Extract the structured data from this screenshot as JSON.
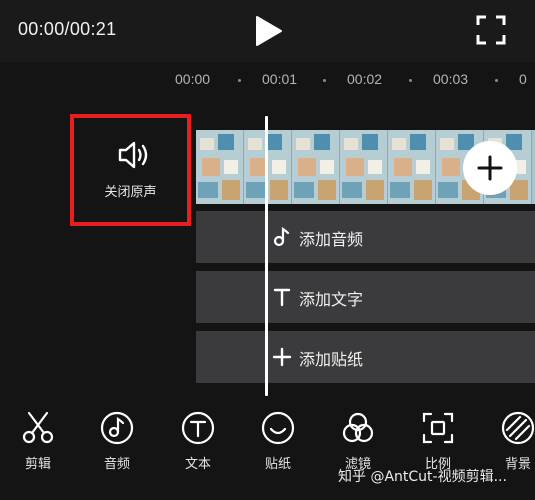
{
  "player": {
    "time_display": "00:00/00:21"
  },
  "ruler": {
    "ticks": [
      "00:00",
      "00:01",
      "00:02",
      "00:03"
    ]
  },
  "audio": {
    "mute_label": "关闭原声"
  },
  "tracks": {
    "audio_label": "添加音频",
    "text_label": "添加文字",
    "sticker_label": "添加贴纸"
  },
  "toolbar": {
    "items": [
      {
        "label": "剪辑",
        "icon": "scissors-icon"
      },
      {
        "label": "音频",
        "icon": "music-disc-icon"
      },
      {
        "label": "文本",
        "icon": "text-circle-icon"
      },
      {
        "label": "贴纸",
        "icon": "smiley-icon"
      },
      {
        "label": "滤镜",
        "icon": "filter-circles-icon"
      },
      {
        "label": "比例",
        "icon": "ratio-frame-icon"
      },
      {
        "label": "背景",
        "icon": "background-stripes-icon"
      }
    ]
  },
  "watermark": {
    "text": "知乎 @AntCut-视频剪辑..."
  },
  "colors": {
    "background": "#141414",
    "track": "#3b3b3d",
    "highlight": "#e61e1e"
  }
}
